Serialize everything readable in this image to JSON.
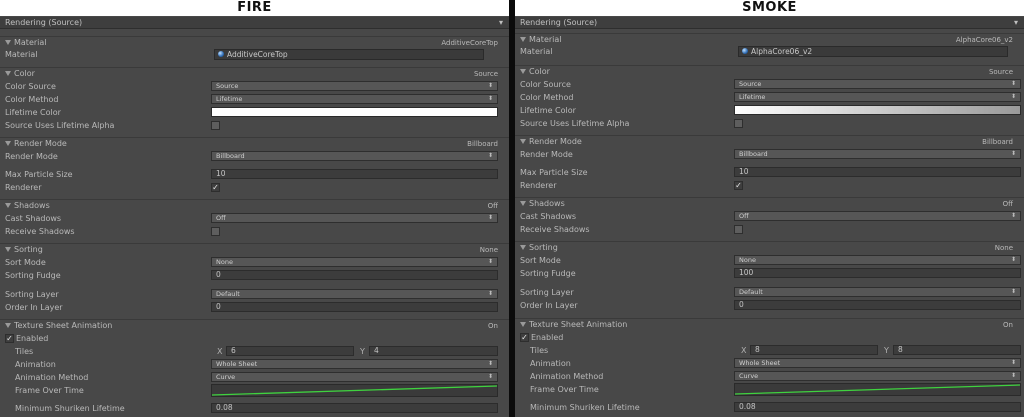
{
  "panels": [
    {
      "id": "fire",
      "title": "FIRE",
      "header": "Rendering (Source)",
      "material": {
        "section": "Material",
        "section_value": "AdditiveCoreTop",
        "label": "Material",
        "value": "AdditiveCoreTop"
      },
      "color": {
        "section": "Color",
        "section_value": "Source",
        "source_label": "Color Source",
        "source_value": "Source",
        "method_label": "Color Method",
        "method_value": "Lifetime",
        "lifetime_label": "Lifetime Color",
        "lifetime_gradient": [
          "#ffffff",
          "#ffffff"
        ],
        "alpha_label": "Source Uses Lifetime Alpha",
        "alpha_checked": false
      },
      "render_mode": {
        "section": "Render Mode",
        "section_value": "Billboard",
        "label": "Render Mode",
        "value": "Billboard",
        "max_label": "Max Particle Size",
        "max_value": "10",
        "renderer_label": "Renderer",
        "renderer_checked": true
      },
      "shadows": {
        "section": "Shadows",
        "section_value": "Off",
        "cast_label": "Cast Shadows",
        "cast_value": "Off",
        "receive_label": "Receive Shadows",
        "receive_checked": false
      },
      "sorting": {
        "section": "Sorting",
        "section_value": "None",
        "mode_label": "Sort Mode",
        "mode_value": "None",
        "fudge_label": "Sorting Fudge",
        "fudge_value": "0",
        "layer_label": "Sorting Layer",
        "layer_value": "Default",
        "order_label": "Order In Layer",
        "order_value": "0"
      },
      "tsa": {
        "section": "Texture Sheet Animation",
        "section_value": "On",
        "enabled_label": "Enabled",
        "enabled_checked": true,
        "tiles_label": "Tiles",
        "x_label": "X",
        "x_value": "6",
        "y_label": "Y",
        "y_value": "4",
        "anim_label": "Animation",
        "anim_value": "Whole Sheet",
        "method_label": "Animation Method",
        "method_value": "Curve",
        "frame_label": "Frame Over Time",
        "min_label": "Minimum Shuriken Lifetime",
        "min_value": "0.08"
      }
    },
    {
      "id": "smoke",
      "title": "SMOKE",
      "header": "Rendering (Source)",
      "material": {
        "section": "Material",
        "section_value": "AlphaCore06_v2",
        "label": "Material",
        "value": "AlphaCore06_v2"
      },
      "color": {
        "section": "Color",
        "section_value": "Source",
        "source_label": "Color Source",
        "source_value": "Source",
        "method_label": "Color Method",
        "method_value": "Lifetime",
        "lifetime_label": "Lifetime Color",
        "lifetime_gradient": [
          "#ffffff",
          "#9a9a9a"
        ],
        "alpha_label": "Source Uses Lifetime Alpha",
        "alpha_checked": false
      },
      "render_mode": {
        "section": "Render Mode",
        "section_value": "Billboard",
        "label": "Render Mode",
        "value": "Billboard",
        "max_label": "Max Particle Size",
        "max_value": "10",
        "renderer_label": "Renderer",
        "renderer_checked": true
      },
      "shadows": {
        "section": "Shadows",
        "section_value": "Off",
        "cast_label": "Cast Shadows",
        "cast_value": "Off",
        "receive_label": "Receive Shadows",
        "receive_checked": false
      },
      "sorting": {
        "section": "Sorting",
        "section_value": "None",
        "mode_label": "Sort Mode",
        "mode_value": "None",
        "fudge_label": "Sorting Fudge",
        "fudge_value": "100",
        "layer_label": "Sorting Layer",
        "layer_value": "Default",
        "order_label": "Order In Layer",
        "order_value": "0"
      },
      "tsa": {
        "section": "Texture Sheet Animation",
        "section_value": "On",
        "enabled_label": "Enabled",
        "enabled_checked": true,
        "tiles_label": "Tiles",
        "x_label": "X",
        "x_value": "8",
        "y_label": "Y",
        "y_value": "8",
        "anim_label": "Animation",
        "anim_value": "Whole Sheet",
        "method_label": "Animation Method",
        "method_value": "Curve",
        "frame_label": "Frame Over Time",
        "min_label": "Minimum Shuriken Lifetime",
        "min_value": "0.08"
      }
    }
  ],
  "icons": {
    "section_toggle": "triangle-down-icon",
    "object_picker": "target-icon",
    "material_thumb": "sphere-icon",
    "dropdown": "updown-arrow-icon",
    "check": "check-icon"
  },
  "colors": {
    "panel_bg": "#484848",
    "curve": "#3fd23f",
    "divider": "#0b0b0b"
  }
}
